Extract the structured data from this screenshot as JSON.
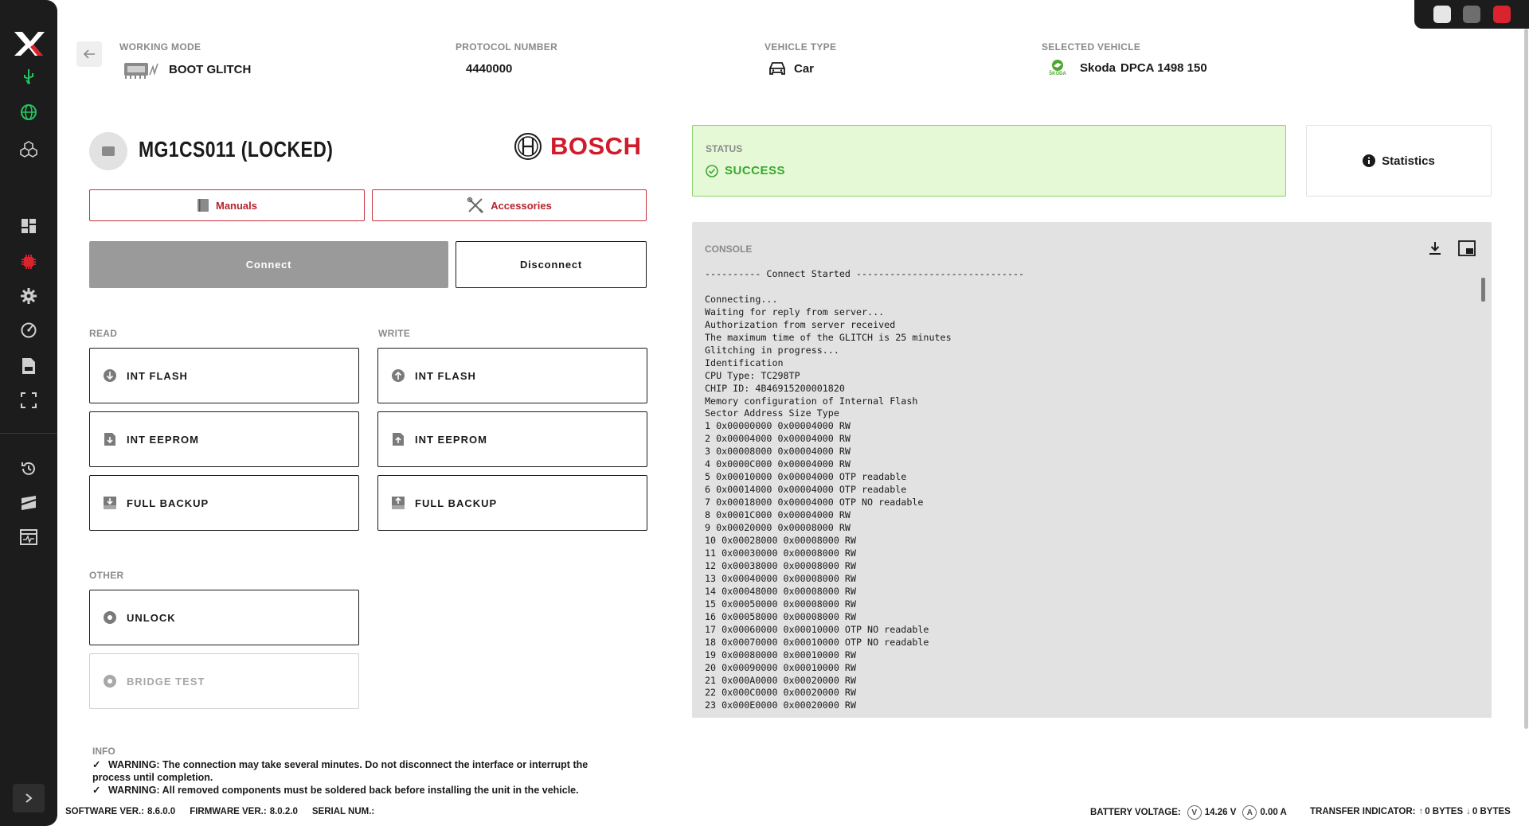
{
  "window_controls": {
    "colors": [
      "#e6e6e6",
      "#6e6e6e",
      "#d9232e"
    ]
  },
  "sidebar": {
    "top_icons": [
      "usb-icon",
      "globe-icon",
      "cubes-icon"
    ],
    "mid_icons": [
      "dashboard-icon",
      "chip-icon",
      "gear-icon",
      "gauge-icon",
      "log-file-icon",
      "fullscreen-icon"
    ],
    "bottom_icons": [
      "history-icon",
      "flag-icon",
      "monitor-icon"
    ],
    "active_color": "#22c55e",
    "accent_color": "#d9232e"
  },
  "header": {
    "working_mode_label": "WORKING MODE",
    "working_mode_value": "BOOT GLITCH",
    "protocol_label": "PROTOCOL NUMBER",
    "protocol_value": "4440000",
    "vehicle_type_label": "VEHICLE TYPE",
    "vehicle_type_value": "Car",
    "selected_vehicle_label": "SELECTED VEHICLE",
    "selected_vehicle_brand": "Skoda",
    "selected_vehicle_logo_text": "ŠKODA",
    "selected_vehicle_model": "DPCA 1498 150"
  },
  "ecu": {
    "title": "MG1CS011 (LOCKED)",
    "manufacturer": "BOSCH"
  },
  "actions": {
    "manuals": "Manuals",
    "accessories": "Accessories",
    "connect": "Connect",
    "disconnect": "Disconnect"
  },
  "read": {
    "label": "READ",
    "items": [
      "INT FLASH",
      "INT EEPROM",
      "FULL BACKUP"
    ]
  },
  "write": {
    "label": "WRITE",
    "items": [
      "INT FLASH",
      "INT EEPROM",
      "FULL BACKUP"
    ]
  },
  "other": {
    "label": "OTHER",
    "unlock": "UNLOCK",
    "bridge_test": "BRIDGE TEST"
  },
  "info": {
    "label": "INFO",
    "warning1_line1": "WARNING: The connection may take several minutes. Do not disconnect the interface or interrupt the",
    "warning1_line2": "process until completion.",
    "warning2": "WARNING: All removed components must be soldered back before installing the unit in the vehicle."
  },
  "status": {
    "label": "STATUS",
    "value": "SUCCESS",
    "color": "#3aa72f"
  },
  "statistics": "Statistics",
  "console": {
    "label": "CONSOLE",
    "lines": [
      "---------- Connect Started ------------------------------",
      "",
      "Connecting...",
      "Waiting for reply from server...",
      "Authorization from server received",
      "The maximum time of the GLITCH is 25 minutes",
      "Glitching in progress...",
      "Identification",
      "CPU Type: TC298TP",
      "CHIP ID: 4B46915200001820",
      "Memory configuration of Internal Flash",
      "Sector Address Size Type",
      "1 0x00000000 0x00004000 RW",
      "2 0x00004000 0x00004000 RW",
      "3 0x00008000 0x00004000 RW",
      "4 0x0000C000 0x00004000 RW",
      "5 0x00010000 0x00004000 OTP readable",
      "6 0x00014000 0x00004000 OTP readable",
      "7 0x00018000 0x00004000 OTP NO readable",
      "8 0x0001C000 0x00004000 RW",
      "9 0x00020000 0x00008000 RW",
      "10 0x00028000 0x00008000 RW",
      "11 0x00030000 0x00008000 RW",
      "12 0x00038000 0x00008000 RW",
      "13 0x00040000 0x00008000 RW",
      "14 0x00048000 0x00008000 RW",
      "15 0x00050000 0x00008000 RW",
      "16 0x00058000 0x00008000 RW",
      "17 0x00060000 0x00010000 OTP NO readable",
      "18 0x00070000 0x00010000 OTP NO readable",
      "19 0x00080000 0x00010000 RW",
      "20 0x00090000 0x00010000 RW",
      "21 0x000A0000 0x00020000 RW",
      "22 0x000C0000 0x00020000 RW",
      "23 0x000E0000 0x00020000 RW"
    ]
  },
  "footer": {
    "software_label": "SOFTWARE VER.:",
    "software_value": "8.6.0.0",
    "firmware_label": "FIRMWARE VER.:",
    "firmware_value": "8.0.2.0",
    "serial_label": "SERIAL NUM.:",
    "serial_value": "",
    "battery_label": "BATTERY VOLTAGE:",
    "voltage_unit_icon": "V",
    "voltage_value": "14.26 V",
    "current_unit_icon": "A",
    "current_value": "0.00 A",
    "transfer_label": "TRANSFER INDICATOR:",
    "upload_value": "0 BYTES",
    "download_value": "0 BYTES"
  }
}
